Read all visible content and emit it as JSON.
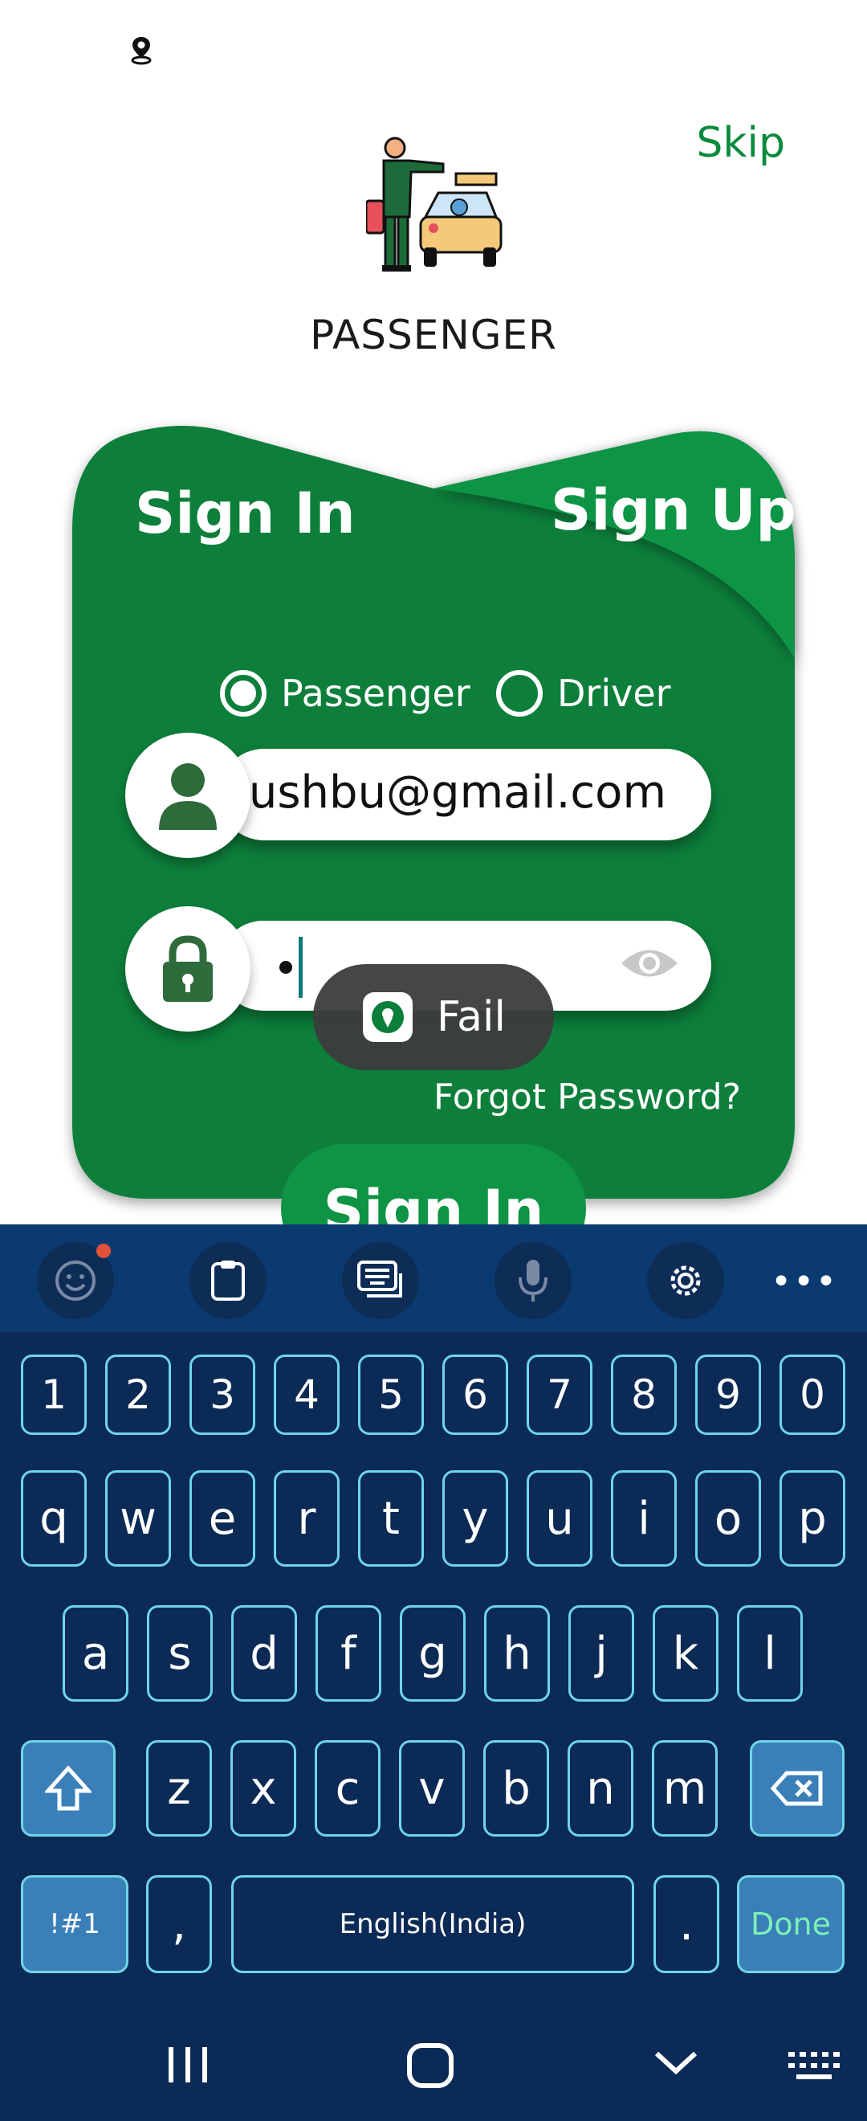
{
  "header": {
    "skip_label": "Skip",
    "role_title": "PASSENGER"
  },
  "auth": {
    "tab_signin": "Sign In",
    "tab_signup": "Sign Up",
    "radio_passenger": "Passenger",
    "radio_driver": "Driver",
    "selected_role": "Passenger",
    "email_value": "ıushbu@gmail.com",
    "password_masked": "•",
    "forgot_label": "Forgot Password?",
    "signin_button": "Sign In"
  },
  "toast": {
    "message": "Fail"
  },
  "keyboard": {
    "toolbar": [
      "emoji-icon",
      "clipboard-icon",
      "keyboard-mode-icon",
      "mic-icon",
      "settings-icon",
      "more-icon"
    ],
    "more_label": "•••",
    "row_numbers": [
      "1",
      "2",
      "3",
      "4",
      "5",
      "6",
      "7",
      "8",
      "9",
      "0"
    ],
    "row_q": [
      "q",
      "w",
      "e",
      "r",
      "t",
      "y",
      "u",
      "i",
      "o",
      "p"
    ],
    "row_a": [
      "a",
      "s",
      "d",
      "f",
      "g",
      "h",
      "j",
      "k",
      "l"
    ],
    "row_z": [
      "z",
      "x",
      "c",
      "v",
      "b",
      "n",
      "m"
    ],
    "symbols_label": "!#1",
    "comma_label": ",",
    "space_label": "English(India)",
    "period_label": ".",
    "done_label": "Done"
  },
  "colors": {
    "brand_green": "#0a7f3a",
    "skip_green": "#0a8a3c",
    "keyboard_bg": "#0b2a55",
    "key_border": "#6ed6e6",
    "done_text": "#7ef0b8"
  }
}
